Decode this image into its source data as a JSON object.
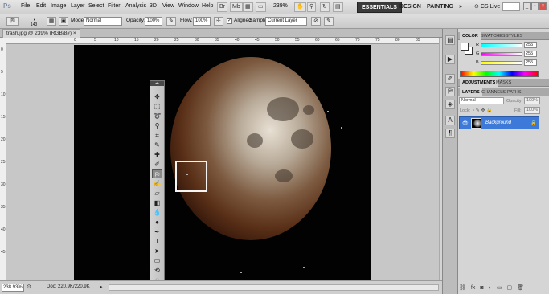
{
  "app": {
    "logo": "Ps",
    "menu": [
      "File",
      "Edit",
      "Image",
      "Layer",
      "Select",
      "Filter",
      "Analysis",
      "3D",
      "View",
      "Window",
      "Help"
    ],
    "zoom_display": "239%",
    "workspaces": [
      "ESSENTIALS",
      "DESIGN",
      "PAINTING"
    ],
    "workspace_more": "»",
    "cs_live": "CS Live"
  },
  "options": {
    "brush_size": "143",
    "mode_label": "Mode:",
    "mode_value": "Normal",
    "opacity_label": "Opacity:",
    "opacity_value": "100%",
    "flow_label": "Flow:",
    "flow_value": "100%",
    "aligned_label": "Aligned",
    "sample_label": "Sample:",
    "sample_value": "Current Layer"
  },
  "document": {
    "tab_title": "trash.jpg @ 239% (RGB/8#)",
    "ruler_top_ticks": [
      "0",
      "5",
      "10",
      "15",
      "20",
      "25",
      "30",
      "35",
      "40",
      "45",
      "50",
      "55",
      "60",
      "65",
      "70",
      "75",
      "80",
      "85"
    ],
    "ruler_left_ticks": [
      "0",
      "5",
      "10",
      "15",
      "20",
      "25",
      "30",
      "35",
      "40",
      "45"
    ]
  },
  "status": {
    "zoom": "238.93%",
    "doc_info": "Doc: 220.9K/220.9K"
  },
  "panels": {
    "top_tabs": [
      "COLOR",
      "SWATCHES",
      "STYLES"
    ],
    "color_rows": [
      {
        "label": "R",
        "value": "255",
        "color": "#ff0000"
      },
      {
        "label": "G",
        "value": "255",
        "color": "#00ff00"
      },
      {
        "label": "B",
        "value": "255",
        "color": "#0000ff"
      }
    ],
    "mid_tabs": [
      "ADJUSTMENTS",
      "MASKS"
    ],
    "layer_tabs": [
      "LAYERS",
      "CHANNELS",
      "PATHS"
    ],
    "blend_mode": "Normal",
    "opacity_label": "Opacity:",
    "opacity_value": "100%",
    "lock_label": "Lock:",
    "fill_label": "Fill:",
    "fill_value": "100%",
    "layer_name": "Background"
  }
}
